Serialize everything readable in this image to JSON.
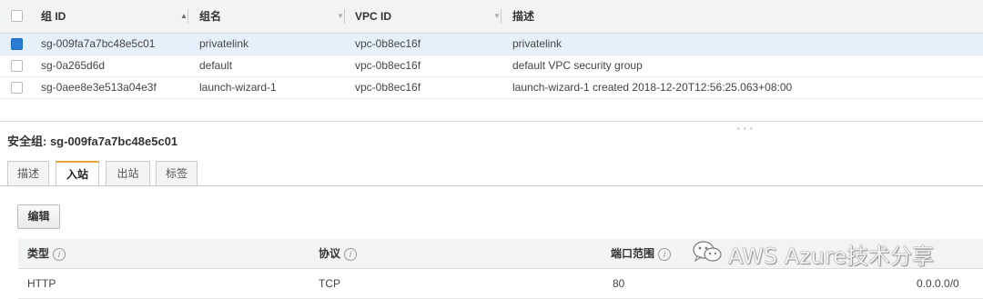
{
  "table": {
    "columns": {
      "group_id": "组 ID",
      "group_name": "组名",
      "vpc_id": "VPC ID",
      "description": "描述"
    },
    "rows": [
      {
        "selected": true,
        "group_id": "sg-009fa7a7bc48e5c01",
        "group_name": "privatelink",
        "vpc_id": "vpc-0b8ec16f",
        "description": "privatelink"
      },
      {
        "selected": false,
        "group_id": "sg-0a265d6d",
        "group_name": "default",
        "vpc_id": "vpc-0b8ec16f",
        "description": "default VPC security group"
      },
      {
        "selected": false,
        "group_id": "sg-0aee8e3e513a04e3f",
        "group_name": "launch-wizard-1",
        "vpc_id": "vpc-0b8ec16f",
        "description": "launch-wizard-1 created 2018-12-20T12:56:25.063+08:00"
      }
    ]
  },
  "detail": {
    "title": "安全组: sg-009fa7a7bc48e5c01",
    "tabs": [
      "描述",
      "入站",
      "出站",
      "标签"
    ],
    "active_tab": "入站",
    "edit_label": "编辑",
    "rules_columns": {
      "type": "类型",
      "protocol": "协议",
      "port_range": "端口范围"
    },
    "rules": [
      {
        "type": "HTTP",
        "protocol": "TCP",
        "port_range": "80",
        "source": "0.0.0.0/0"
      }
    ]
  },
  "watermark": "AWS Azure技术分享",
  "colors": {
    "accent": "#e8a530",
    "selected_row": "#e6f0fb",
    "checkbox_on": "#2a7cd3"
  }
}
